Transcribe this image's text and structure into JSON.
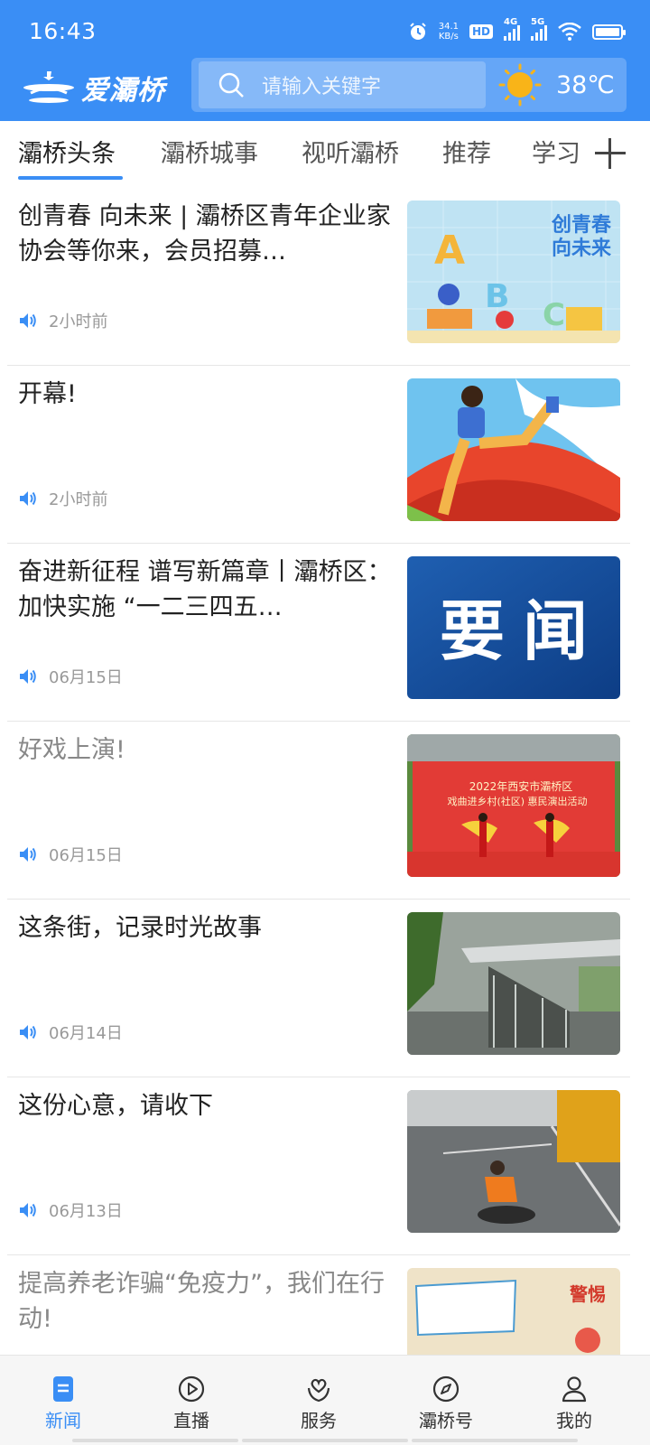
{
  "status_bar": {
    "time": "16:43",
    "net_speed_value": "34.1",
    "net_speed_unit": "KB/s",
    "hd_label": "HD",
    "signal_1": "4G",
    "signal_2": "5G"
  },
  "header": {
    "logo_text": "爱灞桥",
    "search_placeholder": "请输入关键字",
    "weather_temp": "38℃",
    "brand_color": "#3a8ef5"
  },
  "tabs": [
    {
      "label": "灞桥头条",
      "active": true
    },
    {
      "label": "灞桥城事",
      "active": false
    },
    {
      "label": "视听灞桥",
      "active": false
    },
    {
      "label": "推荐",
      "active": false
    },
    {
      "label": "学习",
      "active": false
    }
  ],
  "news": [
    {
      "title": "创青春 向未来 | 灞桥区青年企业家协会等你来，会员招募…",
      "time": "2小时前",
      "read": false,
      "image_text": "创青春\n向未来",
      "image": "cartoon-students-abc-illustration"
    },
    {
      "title": "开幕!",
      "time": "2小时前",
      "read": false,
      "image_text": "",
      "image": "cartoon-athlete-kicking"
    },
    {
      "title": "奋进新征程 谱写新篇章丨灞桥区：加快实施 “一二三四五…",
      "time": "06月15日",
      "read": false,
      "image_text": "要 闻",
      "image": "blue-headline-banner"
    },
    {
      "title": "好戏上演!",
      "time": "06月15日",
      "read": true,
      "image_text": "2022年西安市灞桥区\n戏曲进乡村(社区) 惠民演出活动",
      "image": "opera-stage-performance-photo"
    },
    {
      "title": "这条街，记录时光故事",
      "time": "06月14日",
      "read": false,
      "image_text": "",
      "image": "street-stairway-photo"
    },
    {
      "title": "这份心意，请收下",
      "time": "06月13日",
      "read": false,
      "image_text": "",
      "image": "worker-fixing-road-drain-photo"
    },
    {
      "title": "提高养老诈骗“免疫力”，我们在行动!",
      "time": "",
      "read": true,
      "image_text": "警惕",
      "image": "anti-fraud-poster"
    }
  ],
  "bottom_nav": [
    {
      "label": "新闻",
      "icon": "news-icon",
      "active": true
    },
    {
      "label": "直播",
      "icon": "live-play-icon",
      "active": false
    },
    {
      "label": "服务",
      "icon": "service-icon",
      "active": false
    },
    {
      "label": "灞桥号",
      "icon": "compass-icon",
      "active": false
    },
    {
      "label": "我的",
      "icon": "profile-icon",
      "active": false
    }
  ]
}
